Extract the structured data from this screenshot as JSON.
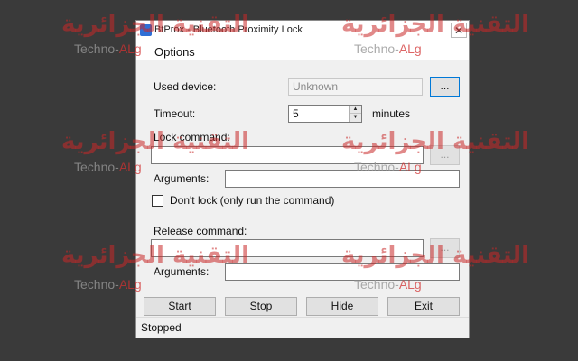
{
  "window": {
    "title": "BtProx - Bluetooth Proximity Lock",
    "close_glyph": "✕"
  },
  "menu": {
    "options_label": "Options"
  },
  "form": {
    "used_device_label": "Used device:",
    "used_device_value": "Unknown",
    "browse_device_label": "...",
    "timeout_label": "Timeout:",
    "timeout_value": "5",
    "timeout_unit": "minutes",
    "spin_up_glyph": "▲",
    "spin_down_glyph": "▼",
    "lock_command_label": "Lock command:",
    "lock_command_value": "",
    "browse_lock_label": "...",
    "lock_arguments_label": "Arguments:",
    "lock_arguments_value": "",
    "dont_lock_label": "Don't lock (only run the command)",
    "dont_lock_checked": false,
    "release_command_label": "Release command:",
    "release_command_value": "",
    "browse_release_label": "...",
    "release_arguments_label": "Arguments:",
    "release_arguments_value": ""
  },
  "buttons": {
    "start": "Start",
    "stop": "Stop",
    "hide": "Hide",
    "exit": "Exit"
  },
  "status": {
    "text": "Stopped"
  },
  "watermark": {
    "arabic_text": "التقنية الجزائرية",
    "latin_text": "Techno-",
    "latin_accent": "ALg",
    "logo_mark": "ᵃʟᵍ"
  },
  "colors": {
    "accent_focus": "#0078d7",
    "window_bg": "#f0f0f0",
    "desktop_bg": "#3a3a3a",
    "watermark_red": "#c82828"
  }
}
